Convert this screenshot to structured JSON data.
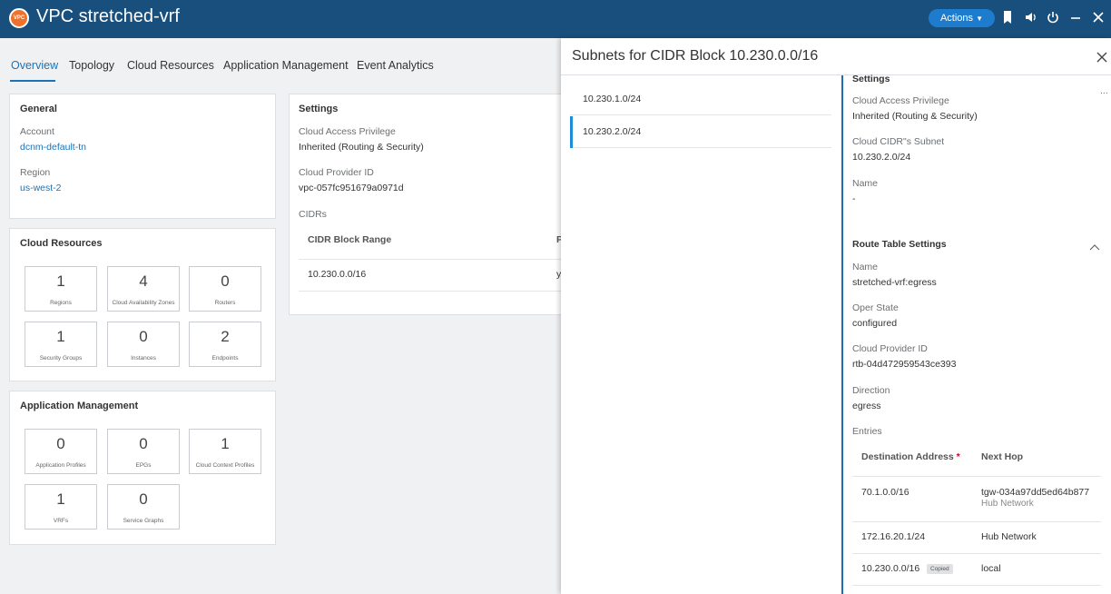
{
  "header": {
    "logo_text": "VPC",
    "title": "VPC stretched-vrf",
    "actions_label": "Actions",
    "icons": [
      "bookmark-icon",
      "speaker-icon",
      "power-icon",
      "minimize-icon",
      "close-icon"
    ]
  },
  "tabs": [
    {
      "label": "Overview",
      "active": true
    },
    {
      "label": "Topology"
    },
    {
      "label": "Cloud Resources"
    },
    {
      "label": "Application Management"
    },
    {
      "label": "Event Analytics"
    }
  ],
  "general": {
    "title": "General",
    "account_label": "Account",
    "account_value": "dcnm-default-tn",
    "region_label": "Region",
    "region_value": "us-west-2"
  },
  "cloud_resources": {
    "title": "Cloud Resources",
    "stats": [
      {
        "value": "1",
        "label": "Regions"
      },
      {
        "value": "4",
        "label": "Cloud Availability Zones"
      },
      {
        "value": "0",
        "label": "Routers"
      },
      {
        "value": "1",
        "label": "Security Groups"
      },
      {
        "value": "0",
        "label": "Instances"
      },
      {
        "value": "2",
        "label": "Endpoints"
      }
    ]
  },
  "app_mgmt": {
    "title": "Application Management",
    "stats": [
      {
        "value": "0",
        "label": "Application Profiles"
      },
      {
        "value": "0",
        "label": "EPGs"
      },
      {
        "value": "1",
        "label": "Cloud Context Profiles"
      },
      {
        "value": "1",
        "label": "VRFs"
      },
      {
        "value": "0",
        "label": "Service Graphs"
      }
    ]
  },
  "settings": {
    "title": "Settings",
    "access_label": "Cloud Access Privilege",
    "access_value": "Inherited (Routing & Security)",
    "provider_label": "Cloud Provider ID",
    "provider_value": "vpc-057fc951679a0971d",
    "cidrs_label": "CIDRs",
    "col_range": "CIDR Block Range",
    "col_p": "P",
    "row_range": "10.230.0.0/16",
    "row_p": "y"
  },
  "panel": {
    "title": "Subnets for CIDR Block 10.230.0.0/16",
    "subnets": [
      {
        "label": "10.230.1.0/24",
        "selected": false
      },
      {
        "label": "10.230.2.0/24",
        "selected": true
      }
    ],
    "settings_title": "Settings",
    "access_label": "Cloud Access Privilege",
    "access_value": "Inherited (Routing & Security)",
    "cidr_subnet_label": "Cloud CIDR\"s Subnet",
    "cidr_subnet_value": "10.230.2.0/24",
    "name_label": "Name",
    "name_value": "-",
    "route_title": "Route Table Settings",
    "rt_name_label": "Name",
    "rt_name_value": "stretched-vrf:egress",
    "oper_label": "Oper State",
    "oper_value": "configured",
    "rt_provider_label": "Cloud Provider ID",
    "rt_provider_value": "rtb-04d472959543ce393",
    "direction_label": "Direction",
    "direction_value": "egress",
    "entries_label": "Entries",
    "col_dest": "Destination Address",
    "col_dest_req": "*",
    "col_next": "Next Hop",
    "entries": [
      {
        "dest": "70.1.0.0/16",
        "next": "tgw-034a97dd5ed64b877",
        "next_sub": "Hub Network"
      },
      {
        "dest": "172.16.20.1/24",
        "next": "Hub Network"
      },
      {
        "dest": "10.230.0.0/16",
        "badge": "Copied",
        "next": "local"
      }
    ],
    "more_text": "..."
  }
}
